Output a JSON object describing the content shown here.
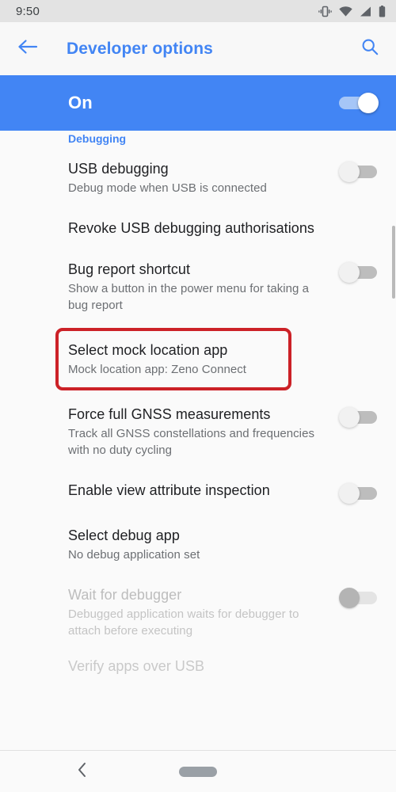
{
  "status_bar": {
    "clock": "9:50",
    "icons": [
      "vibrate-icon",
      "wifi-icon",
      "cellular-signal-icon",
      "battery-icon"
    ]
  },
  "app_bar": {
    "back_icon": "back-arrow-icon",
    "title": "Developer options",
    "search_icon": "search-icon",
    "accent_color": "#4285f4"
  },
  "master_switch": {
    "label": "On",
    "enabled": true,
    "banner_color": "#4285f4"
  },
  "section": {
    "header": "Debugging"
  },
  "highlight": {
    "color": "#cc2127",
    "target": "Select mock location app"
  },
  "rows": [
    {
      "title": "USB debugging",
      "subtitle": "Debug mode when USB is connected",
      "control": "toggle",
      "toggle_state": "off",
      "disabled": false
    },
    {
      "title": "Revoke USB debugging authorisations",
      "subtitle": "",
      "control": "none",
      "toggle_state": "",
      "disabled": false
    },
    {
      "title": "Bug report shortcut",
      "subtitle": "Show a button in the power menu for taking a bug report",
      "control": "toggle",
      "toggle_state": "off",
      "disabled": false
    },
    {
      "title": "Select mock location app",
      "subtitle": "Mock location app: Zeno Connect",
      "control": "none",
      "toggle_state": "",
      "disabled": false,
      "highlighted": true
    },
    {
      "title": "Force full GNSS measurements",
      "subtitle": "Track all GNSS constellations and frequencies with no duty cycling",
      "control": "toggle",
      "toggle_state": "off",
      "disabled": false
    },
    {
      "title": "Enable view attribute inspection",
      "subtitle": "",
      "control": "toggle",
      "toggle_state": "off",
      "disabled": false
    },
    {
      "title": "Select debug app",
      "subtitle": "No debug application set",
      "control": "none",
      "toggle_state": "",
      "disabled": false
    },
    {
      "title": "Wait for debugger",
      "subtitle": "Debugged application waits for debugger to attach before executing",
      "control": "toggle",
      "toggle_state": "off-disabled",
      "disabled": true
    },
    {
      "title": "Verify apps over USB",
      "subtitle": "",
      "control": "none",
      "toggle_state": "",
      "disabled": true,
      "clipped": true
    }
  ],
  "nav_bar": {
    "back_icon": "nav-back-chevron-icon",
    "home_icon": "nav-home-pill-icon"
  }
}
